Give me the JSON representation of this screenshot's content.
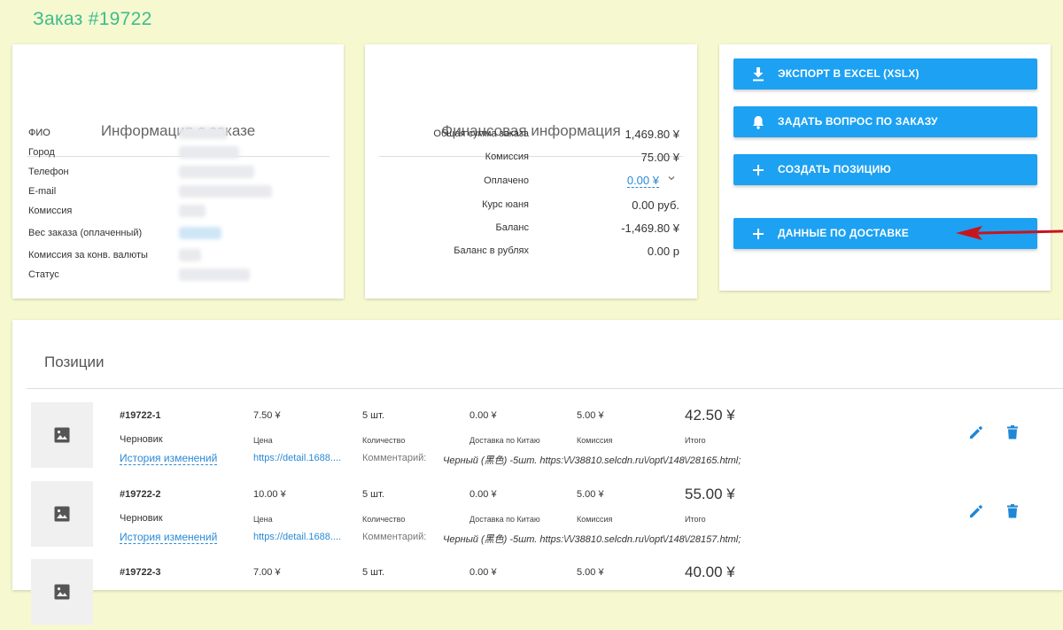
{
  "page_title": "Заказ #19722",
  "info": {
    "title": "Информация о заказе",
    "rows": [
      {
        "label": "ФИО"
      },
      {
        "label": "Город"
      },
      {
        "label": "Телефон"
      },
      {
        "label": "E-mail"
      },
      {
        "label": "Комиссия"
      },
      {
        "label": "Вес заказа (оплаченный)"
      },
      {
        "label": "Комиссия за конв. валюты"
      },
      {
        "label": "Статус"
      }
    ]
  },
  "finance": {
    "title": "Финансовая информация",
    "rows": [
      {
        "label": "Общая сумма заказа",
        "value": "1,469.80 ¥"
      },
      {
        "label": "Комиссия",
        "value": "75.00 ¥"
      },
      {
        "label": "Оплачено",
        "value": "0.00 ¥"
      },
      {
        "label": "Курс юаня",
        "value": "0.00 руб."
      },
      {
        "label": "Баланс",
        "value": "-1,469.80 ¥"
      },
      {
        "label": "Баланс в рублях",
        "value": "0.00 р"
      }
    ]
  },
  "actions": {
    "export": "ЭКСПОРТ В EXCEL (XSLX)",
    "ask": "ЗАДАТЬ ВОПРОС ПО ЗАКАЗУ",
    "create": "СОЗДАТЬ ПОЗИЦИЮ",
    "delivery": "ДАННЫЕ ПО ДОСТАВКЕ"
  },
  "colors": {
    "accent": "#1da1f2",
    "page_bg": "#f6f8cf",
    "title_green": "#3dbd8f",
    "arrow": "#c8141e"
  },
  "positions": {
    "heading": "Позиции",
    "col_labels": {
      "price": "Цена",
      "qty": "Количество",
      "delivery": "Доставка по Китаю",
      "commission": "Комиссия",
      "total": "Итого"
    },
    "history_label": "История изменений",
    "comment_label": "Комментарий:",
    "rows": [
      {
        "id": "#19722-1",
        "status": "Черновик",
        "price": "7.50 ¥",
        "qty": "5 шт.",
        "delivery": "0.00 ¥",
        "commission": "5.00 ¥",
        "total": "42.50 ¥",
        "url": "https://detail.1688....",
        "comment": "Черный (黑色) -5шт. https:\\/\\/38810.selcdn.ru\\/opt\\/148\\/28165.html;"
      },
      {
        "id": "#19722-2",
        "status": "Черновик",
        "price": "10.00 ¥",
        "qty": "5 шт.",
        "delivery": "0.00 ¥",
        "commission": "5.00 ¥",
        "total": "55.00 ¥",
        "url": "https://detail.1688....",
        "comment": "Черный (黑色) -5шт. https:\\/\\/38810.selcdn.ru\\/opt\\/148\\/28157.html;"
      },
      {
        "id": "#19722-3",
        "price": "7.00 ¥",
        "qty": "5 шт.",
        "delivery": "0.00 ¥",
        "commission": "5.00 ¥",
        "total": "40.00 ¥"
      }
    ]
  }
}
